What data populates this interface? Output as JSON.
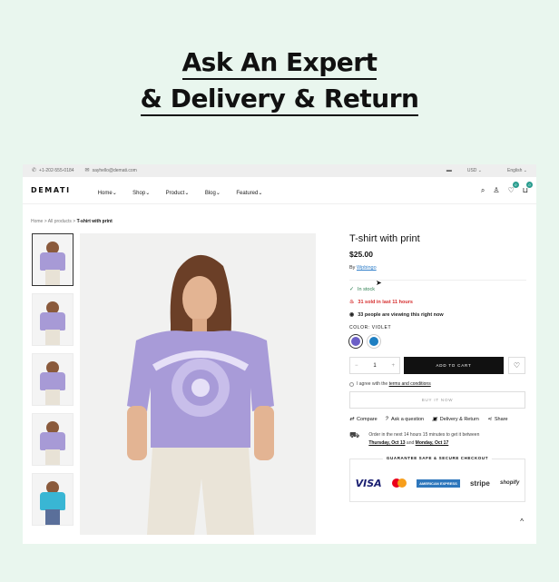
{
  "hero": {
    "line1": "Ask An Expert",
    "line2": "& Delivery & Return"
  },
  "topbar": {
    "phone": "+1-202-555-0184",
    "email": "sayhello@demati.com",
    "currency": "USD",
    "language": "English"
  },
  "nav": {
    "logo": "DEMATI",
    "items": [
      "Home",
      "Shop",
      "Product",
      "Blog",
      "Featured"
    ],
    "wishlist_count": "0",
    "cart_count": "0"
  },
  "breadcrumb": {
    "home": "Home",
    "all": "All products",
    "current": "T-shirt with print"
  },
  "product": {
    "title": "T-shirt with print",
    "price": "$25.00",
    "by_label": "By",
    "vendor": "Wpbingo",
    "in_stock": "In stock",
    "sold": "31 sold in last 11 hours",
    "viewing": "33 people are viewing this right now",
    "color_label": "COLOR: VIOLET",
    "colors": [
      "#6c5fc7",
      "#1e7fc2"
    ],
    "qty": "1",
    "add_to_cart": "ADD TO CART",
    "agree_text": "I agree with the",
    "terms": "terms and conditions",
    "buy_now": "BUY IT NOW",
    "actions": [
      "Compare",
      "Ask a question",
      "Delivery & Return",
      "Share"
    ],
    "order_text": "Order in the next 14 hours 15 minutes to get it between",
    "date1": "Thursday, Oct 13",
    "and": "and",
    "date2": "Monday, Oct 17",
    "guarantee": "GUARANTEE SAFE & SECURE CHECKOUT",
    "payments": [
      "VISA",
      "AMERICAN EXPRESS",
      "stripe",
      "shopify"
    ]
  }
}
